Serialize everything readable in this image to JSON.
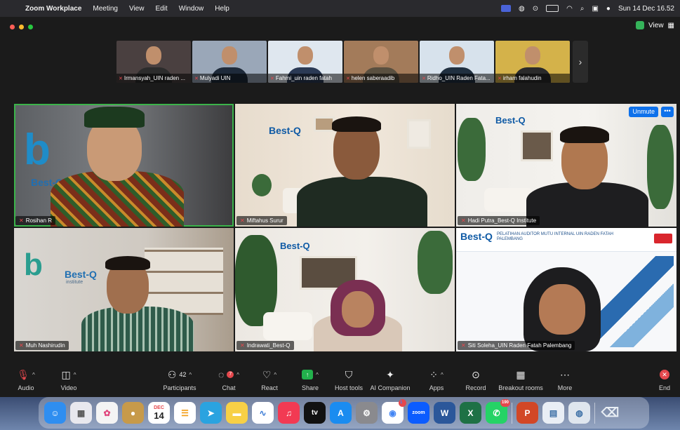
{
  "menubar": {
    "app_name": "Zoom Workplace",
    "menus": [
      "Meeting",
      "View",
      "Edit",
      "Window",
      "Help"
    ],
    "clock": "Sun 14 Dec  16.52"
  },
  "window": {
    "view_label": "View"
  },
  "strip": {
    "participants": [
      {
        "name": "Irmansyah_UIN raden ...",
        "bg": "#4a4040",
        "body": "#2c2c2c"
      },
      {
        "name": "Mulyadi UIN",
        "bg": "#9aa7b8",
        "body": "#1e2a3a"
      },
      {
        "name": "Fahmi_uin raden fatah",
        "bg": "#dfe7ef",
        "body": "#2b3a55"
      },
      {
        "name": "helen saberaadib",
        "bg": "#a37b5a",
        "body": "#5a5040"
      },
      {
        "name": "Ridho_UIN Raden Fata...",
        "bg": "#d7e2ec",
        "body": "#203040"
      },
      {
        "name": "irham falahudin",
        "bg": "#d4b24a",
        "body": "#2a2a2a"
      }
    ],
    "next_glyph": "›"
  },
  "tiles": [
    {
      "name": "Rosihan R",
      "active": true
    },
    {
      "name": "Miftahus Surur",
      "active": false
    },
    {
      "name": "Hadi Putra_Best-Q Institute",
      "active": false
    },
    {
      "name": "Muh Nashirudin",
      "active": false
    },
    {
      "name": "Indrawati_Best-Q",
      "active": false
    },
    {
      "name": "Siti Soleha_UIN Raden Fatah Palembang",
      "active": false
    }
  ],
  "tile_extras": {
    "unmute_label": "Unmute",
    "more_label": "•••",
    "brand_text": "Best-Q",
    "brand_sub": "institute",
    "webinar_banner": "PELATIHAN AUDITOR MUTU INTERNAL UIN RADEN FATAH PALEMBANG"
  },
  "toolbar": {
    "audio": "Audio",
    "video": "Video",
    "participants": "Participants",
    "participants_count": "42",
    "chat": "Chat",
    "chat_badge": "7",
    "react": "React",
    "share": "Share",
    "host_tools": "Host tools",
    "ai_companion": "AI Companion",
    "apps": "Apps",
    "record": "Record",
    "breakout_rooms": "Breakout rooms",
    "more": "More",
    "end": "End"
  },
  "dock": {
    "calendar_month": "DEC",
    "calendar_day": "14",
    "chrome_badge": "1",
    "whatsapp_badge": "190",
    "apps": [
      {
        "id": "finder",
        "color": "#2f8ef0",
        "glyph": "☺"
      },
      {
        "id": "launchpad",
        "color": "#e8e8ee",
        "glyph": "▦"
      },
      {
        "id": "photos",
        "color": "#f4f4f4",
        "glyph": "✿"
      },
      {
        "id": "unknown",
        "color": "#c79a4a",
        "glyph": "●"
      },
      {
        "id": "calendar",
        "color": "#ffffff",
        "glyph": ""
      },
      {
        "id": "reminders",
        "color": "#ffffff",
        "glyph": "☰"
      },
      {
        "id": "telegram",
        "color": "#2aa3e0",
        "glyph": "➤"
      },
      {
        "id": "notes",
        "color": "#f7d046",
        "glyph": "▬"
      },
      {
        "id": "freeform",
        "color": "#ffffff",
        "glyph": "∿"
      },
      {
        "id": "music",
        "color": "#f23a53",
        "glyph": "♫"
      },
      {
        "id": "tv",
        "color": "#111111",
        "glyph": "tv"
      },
      {
        "id": "appstore",
        "color": "#1a8cf0",
        "glyph": "A"
      },
      {
        "id": "settings",
        "color": "#8a8a8e",
        "glyph": "⚙"
      },
      {
        "id": "chrome",
        "color": "#ffffff",
        "glyph": "◉"
      },
      {
        "id": "zoom",
        "color": "#0b5cff",
        "glyph": "zoom"
      },
      {
        "id": "word",
        "color": "#2b579a",
        "glyph": "W"
      },
      {
        "id": "excel",
        "color": "#1e7145",
        "glyph": "X"
      },
      {
        "id": "whatsapp",
        "color": "#25d366",
        "glyph": "✆"
      },
      {
        "id": "powerpoint",
        "color": "#d24726",
        "glyph": "P"
      },
      {
        "id": "preview",
        "color": "#e9eef5",
        "glyph": "▤"
      },
      {
        "id": "screenshot",
        "color": "#dfe6ee",
        "glyph": "◍"
      },
      {
        "id": "trash",
        "color": "#cfd6de",
        "glyph": "🗑"
      }
    ]
  }
}
